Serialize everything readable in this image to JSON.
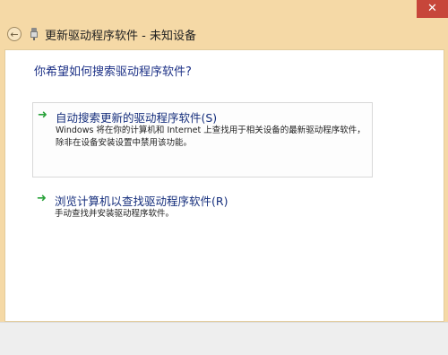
{
  "window": {
    "title": "更新驱动程序软件 - 未知设备",
    "close_glyph": "✕",
    "back_glyph": "←"
  },
  "content": {
    "question": "你希望如何搜索驱动程序软件?",
    "options": [
      {
        "title": "自动搜索更新的驱动程序软件(S)",
        "description": "Windows 将在你的计算机和 Internet 上查找用于相关设备的最新驱动程序软件，除非在设备安装设置中禁用该功能。",
        "arrow": "➜"
      },
      {
        "title": "浏览计算机以查找驱动程序软件(R)",
        "description": "手动查找并安装驱动程序软件。",
        "arrow": "➜"
      }
    ]
  },
  "colors": {
    "frame": "#f5d9a6",
    "close_button": "#c7463a",
    "link_blue": "#152e7c",
    "arrow_green": "#29a23a"
  }
}
